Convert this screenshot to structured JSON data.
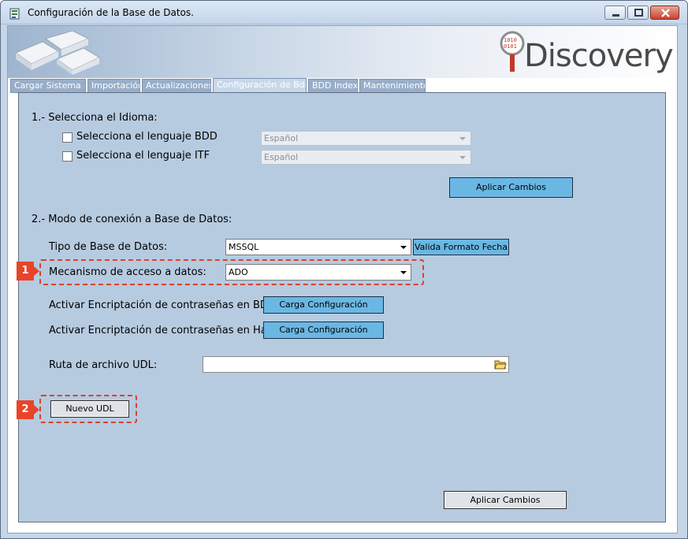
{
  "window": {
    "title": "Configuración de la Base de Datos.",
    "logo_text": "Discovery"
  },
  "tabs": [
    {
      "label": "Cargar Sistema",
      "active": false
    },
    {
      "label": "Importación",
      "active": false
    },
    {
      "label": "Actualizaciones",
      "active": false
    },
    {
      "label": "Configuración de Bdd.",
      "active": true
    },
    {
      "label": "BDD Index",
      "active": false
    },
    {
      "label": "Mantenimiento",
      "active": false
    }
  ],
  "language_section": {
    "heading": "1.- Selecciona el Idioma:",
    "bdd_checkbox_label": "Selecciona el lenguaje BDD",
    "bdd_value": "Español",
    "itf_checkbox_label": "Selecciona el lenguaje ITF",
    "itf_value": "Español",
    "apply_button": "Aplicar Cambios"
  },
  "connection_section": {
    "heading": "2.- Modo de conexión a Base de Datos:",
    "db_type_label": "Tipo de Base de Datos:",
    "db_type_value": "MSSQL",
    "validate_date_button": "Valida Formato Fecha",
    "access_label": "Mecanismo de acceso a datos:",
    "access_value": "ADO",
    "encrypt_bdd_label": "Activar Encriptación de contraseñas en BDD",
    "encrypt_bdd_button": "Carga Configuración",
    "encrypt_hawk_label": "Activar Encriptación de contraseñas en Hawk",
    "encrypt_hawk_button": "Carga Configuración",
    "udl_path_label": "Ruta de archivo UDL:",
    "udl_path_value": "",
    "new_udl_button": "Nuevo UDL",
    "apply_button": "Aplicar Cambios"
  },
  "callouts": {
    "marker1": "1",
    "marker2": "2"
  },
  "colors": {
    "panel": "#b7cbe0",
    "accent_button": "#6ab7e3",
    "callout": "#e8442a"
  }
}
